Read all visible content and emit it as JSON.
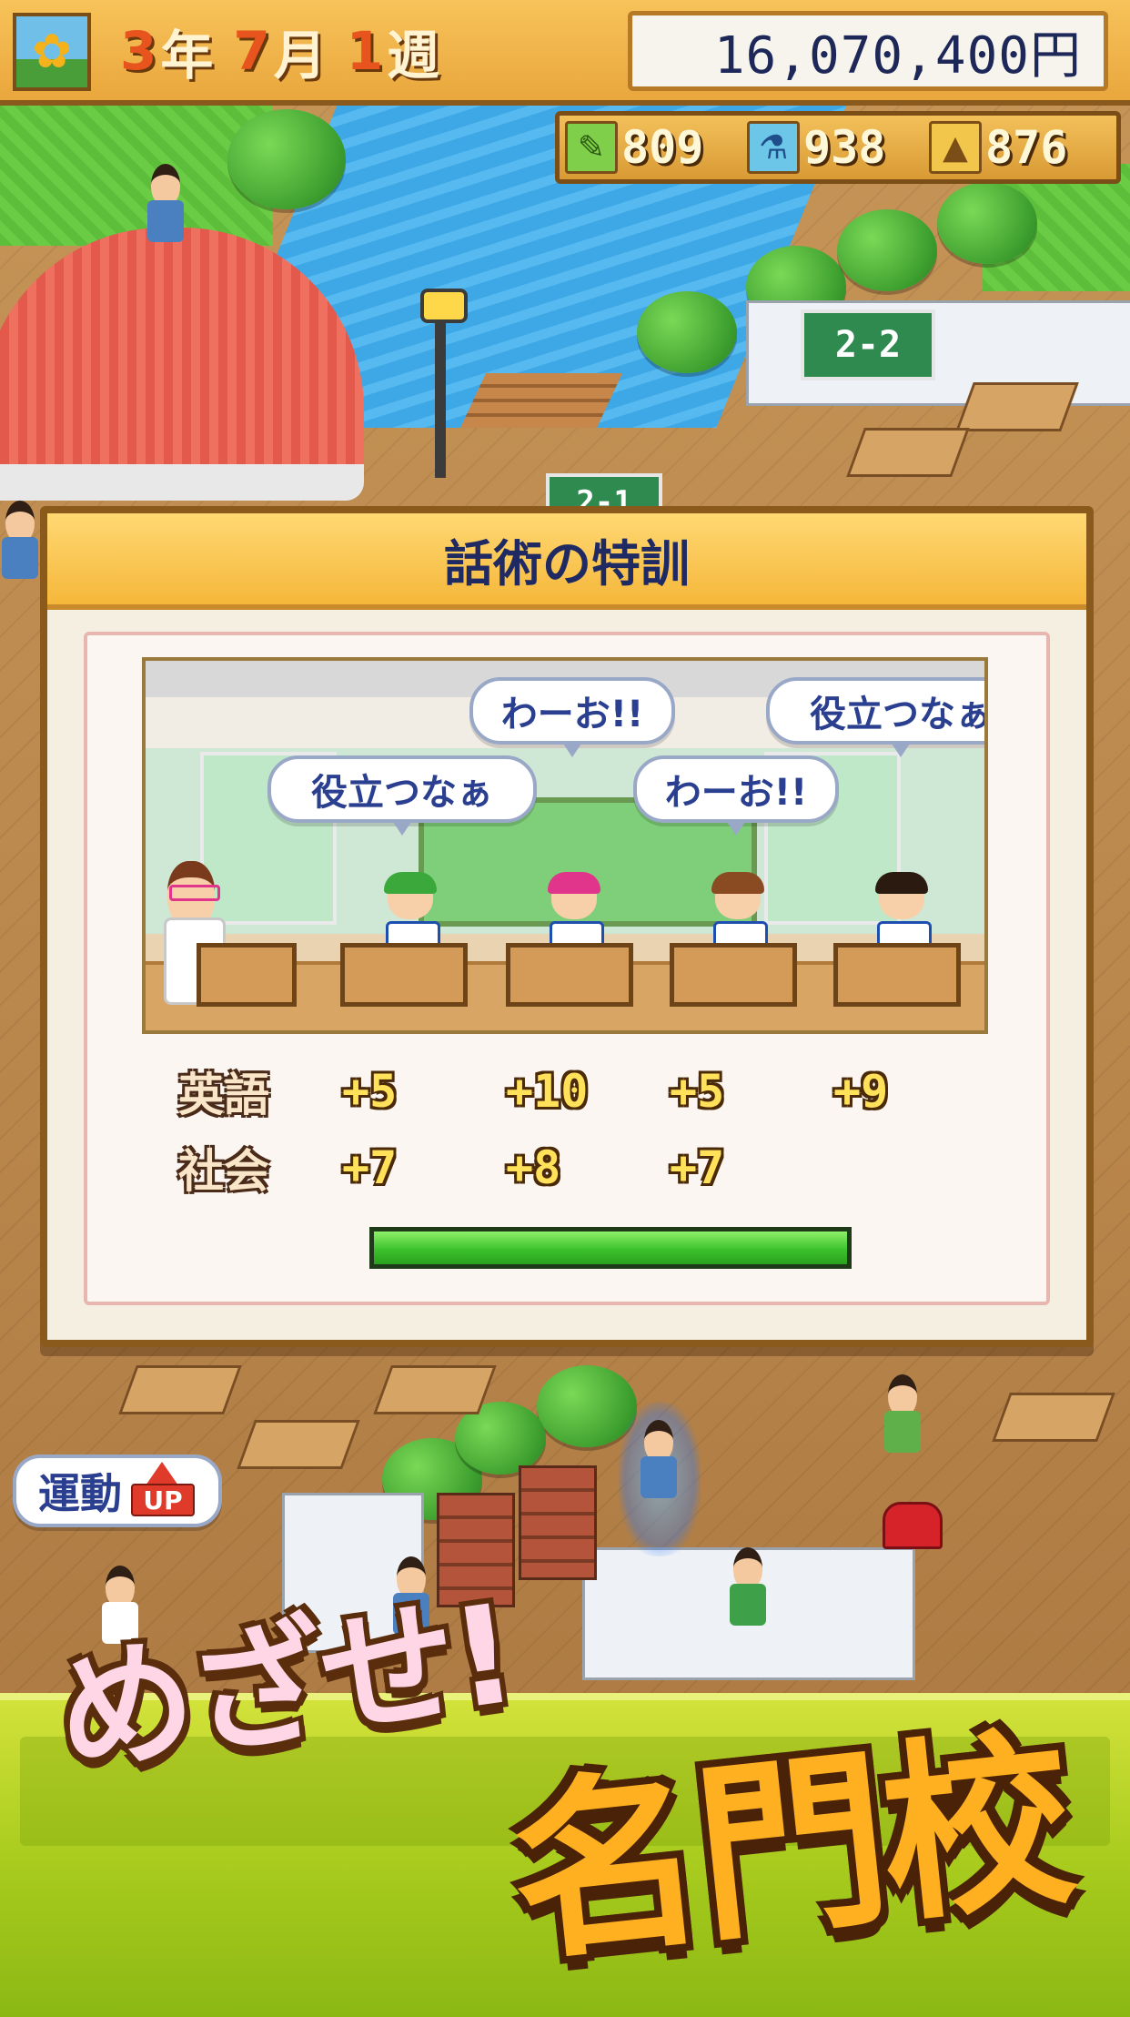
{
  "hud": {
    "date": {
      "year": "3",
      "year_unit": "年",
      "month": "7",
      "month_unit": "月",
      "week": "1",
      "week_unit": "週"
    },
    "money": "16,070,400円",
    "stats": [
      {
        "icon": "pencil-icon",
        "value": "809"
      },
      {
        "icon": "flask-icon",
        "value": "938"
      },
      {
        "icon": "cone-icon",
        "value": "876"
      }
    ]
  },
  "dialog": {
    "title": "話術の特訓",
    "bubbles": [
      "わーお!!",
      "役立つなぁ",
      "役立つなぁ",
      "わーお!!"
    ],
    "results": [
      {
        "subject": "英語",
        "values": [
          "+5",
          "+10",
          "+5",
          "+9"
        ]
      },
      {
        "subject": "社会",
        "values": [
          "+7",
          "+8",
          "+7"
        ]
      }
    ],
    "progress": 1.0
  },
  "popup": {
    "text": "運動",
    "badge": "UP"
  },
  "banner": {
    "tagline": "めざせ!",
    "school_name": "名門校"
  },
  "colors": {
    "hud_orange": "#f7c35a",
    "money_text": "#1d2758",
    "progress_green": "#3cc22c",
    "banner_green": "#a9cc1e"
  }
}
